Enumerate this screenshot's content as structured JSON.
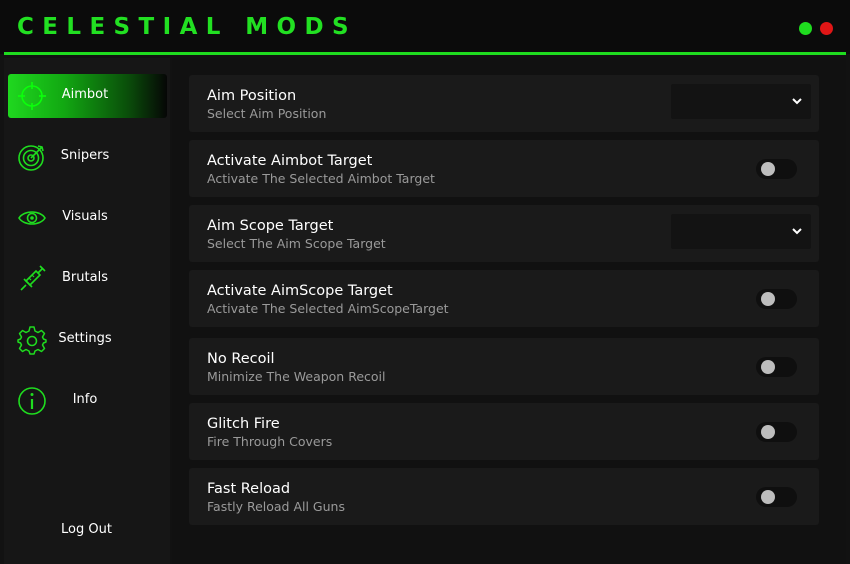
{
  "app": {
    "title": "CELESTIAL MODS"
  },
  "sidebar": {
    "items": [
      {
        "label": "Aimbot",
        "icon": "crosshair-icon",
        "active": true
      },
      {
        "label": "Snipers",
        "icon": "target-icon",
        "active": false
      },
      {
        "label": "Visuals",
        "icon": "eye-icon",
        "active": false
      },
      {
        "label": "Brutals",
        "icon": "syringe-icon",
        "active": false
      },
      {
        "label": "Settings",
        "icon": "gear-icon",
        "active": false
      },
      {
        "label": "Info",
        "icon": "info-icon",
        "active": false
      }
    ],
    "logout_label": "Log Out"
  },
  "settings": [
    {
      "title": "Aim Position",
      "subtitle": "Select Aim Position",
      "control": "dropdown",
      "value": ""
    },
    {
      "title": "Activate Aimbot Target",
      "subtitle": "Activate The Selected Aimbot Target",
      "control": "toggle",
      "on": false
    },
    {
      "title": "Aim Scope Target",
      "subtitle": "Select The Aim Scope Target",
      "control": "dropdown",
      "value": ""
    },
    {
      "title": "Activate AimScope Target",
      "subtitle": "Activate The Selected AimScopeTarget",
      "control": "toggle",
      "on": false
    },
    {
      "title": "No Recoil",
      "subtitle": "Minimize The Weapon Recoil",
      "control": "toggle",
      "on": false
    },
    {
      "title": "Glitch Fire",
      "subtitle": "Fire Through Covers",
      "control": "toggle",
      "on": false
    },
    {
      "title": "Fast Reload",
      "subtitle": "Fastly Reload All Guns",
      "control": "toggle",
      "on": false
    }
  ],
  "colors": {
    "accent": "#1fdc1f",
    "close": "#e01616",
    "background": "#121212",
    "card": "#1a1a1a",
    "subtitle": "#9a9a9a"
  }
}
